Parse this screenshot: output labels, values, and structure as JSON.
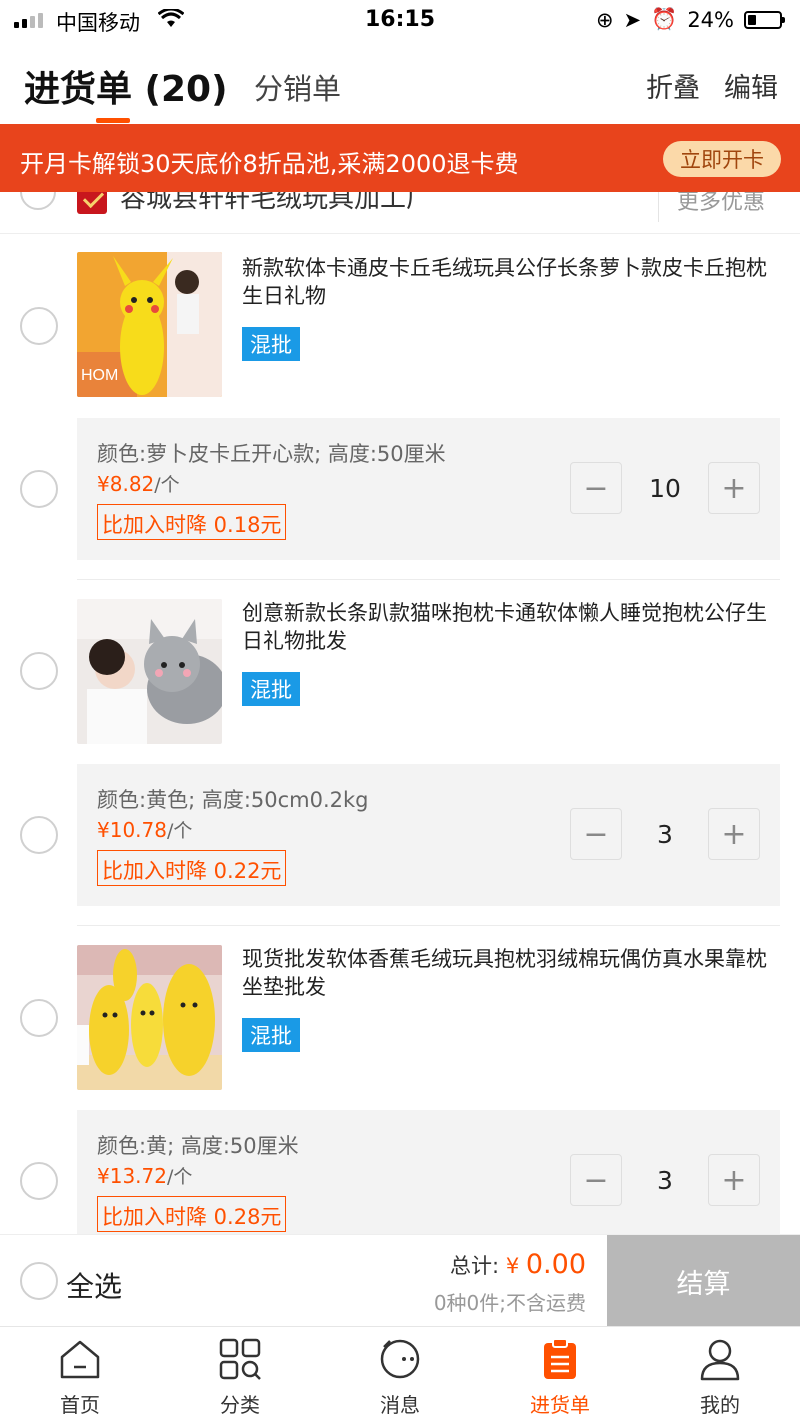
{
  "status_bar": {
    "carrier": "中国移动",
    "time": "16:15",
    "battery": "24%"
  },
  "header": {
    "tab_active": "进货单 (20)",
    "tab_inactive": "分销单",
    "fold": "折叠",
    "edit": "编辑"
  },
  "promo": {
    "text": "开月卡解锁30天底价8折品池,采满2000退卡费",
    "button": "立即开卡"
  },
  "store": {
    "name": "容城县轩轩毛绒玩具加工厂",
    "more": "更多优惠"
  },
  "items": [
    {
      "title": "新款软体卡通皮卡丘毛绒玩具公仔长条萝卜款皮卡丘抱枕生日礼物",
      "badge": "混批",
      "spec": "颜色:萝卜皮卡丘开心款; 高度:50厘米",
      "currency": "¥",
      "price": "8.82",
      "unit": "/个",
      "drop": "比加入时降 0.18元",
      "qty": "10"
    },
    {
      "title": "创意新款长条趴款猫咪抱枕卡通软体懒人睡觉抱枕公仔生日礼物批发",
      "badge": "混批",
      "spec": "颜色:黄色; 高度:50cm0.2kg",
      "currency": "¥",
      "price": "10.78",
      "unit": "/个",
      "drop": "比加入时降 0.22元",
      "qty": "3"
    },
    {
      "title": "现货批发软体香蕉毛绒玩具抱枕羽绒棉玩偶仿真水果靠枕坐垫批发",
      "badge": "混批",
      "spec": "颜色:黄; 高度:50厘米",
      "currency": "¥",
      "price": "13.72",
      "unit": "/个",
      "drop": "比加入时降 0.28元",
      "qty": "3"
    }
  ],
  "stepper": {
    "minus": "−",
    "plus": "+"
  },
  "checkout": {
    "select_all": "全选",
    "total_label": "总计:",
    "currency": "¥",
    "total": "0.00",
    "count": "0种0件;不含运费",
    "button": "结算"
  },
  "tabbar": [
    {
      "label": "首页",
      "icon": "home-icon"
    },
    {
      "label": "分类",
      "icon": "category-icon"
    },
    {
      "label": "消息",
      "icon": "message-icon"
    },
    {
      "label": "进货单",
      "icon": "cart-list-icon"
    },
    {
      "label": "我的",
      "icon": "profile-icon"
    }
  ],
  "colors": {
    "accent": "#ff5000",
    "promo_bg": "#e8441c",
    "badge": "#1a9ae6",
    "checkout_disabled": "#b8b8b8"
  }
}
